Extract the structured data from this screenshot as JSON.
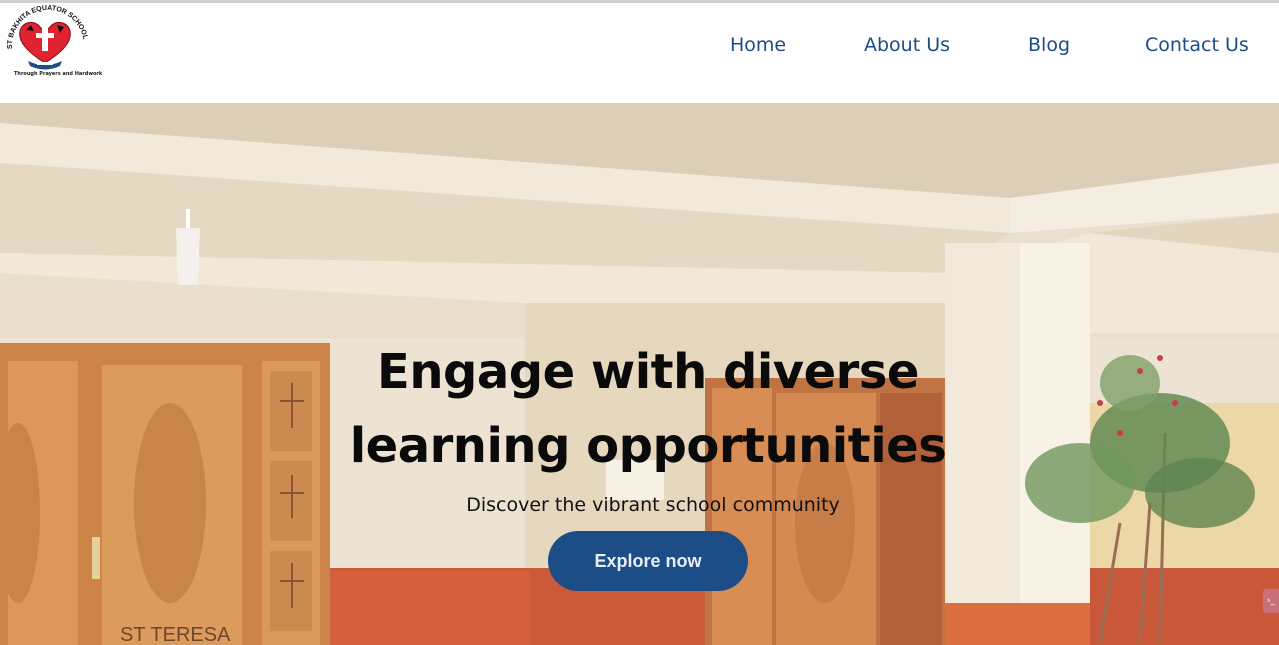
{
  "logo": {
    "arc_text": "ST BAKHITA EQUATOR SCHOOL",
    "tagline": "Through Prayers and Hardwork",
    "colors": {
      "heart": "#e02330",
      "ribbon": "#1d4d86"
    },
    "icon": "cross-heart-crest-icon"
  },
  "nav": {
    "items": [
      {
        "label": "Home"
      },
      {
        "label": "About Us"
      },
      {
        "label": "Blog"
      },
      {
        "label": "Contact Us"
      }
    ]
  },
  "hero": {
    "headline_line1": "Engage with diverse",
    "headline_line2": "learning opportunities",
    "subtitle": "Discover the vibrant school community",
    "cta_label": "Explore now",
    "photo_sign_text": "ST TERESA"
  },
  "side_tab": {
    "icon": "chevron-right-icon",
    "glyph": "›_"
  },
  "colors": {
    "accent": "#1d4d86",
    "headline": "#0a0a0a"
  }
}
